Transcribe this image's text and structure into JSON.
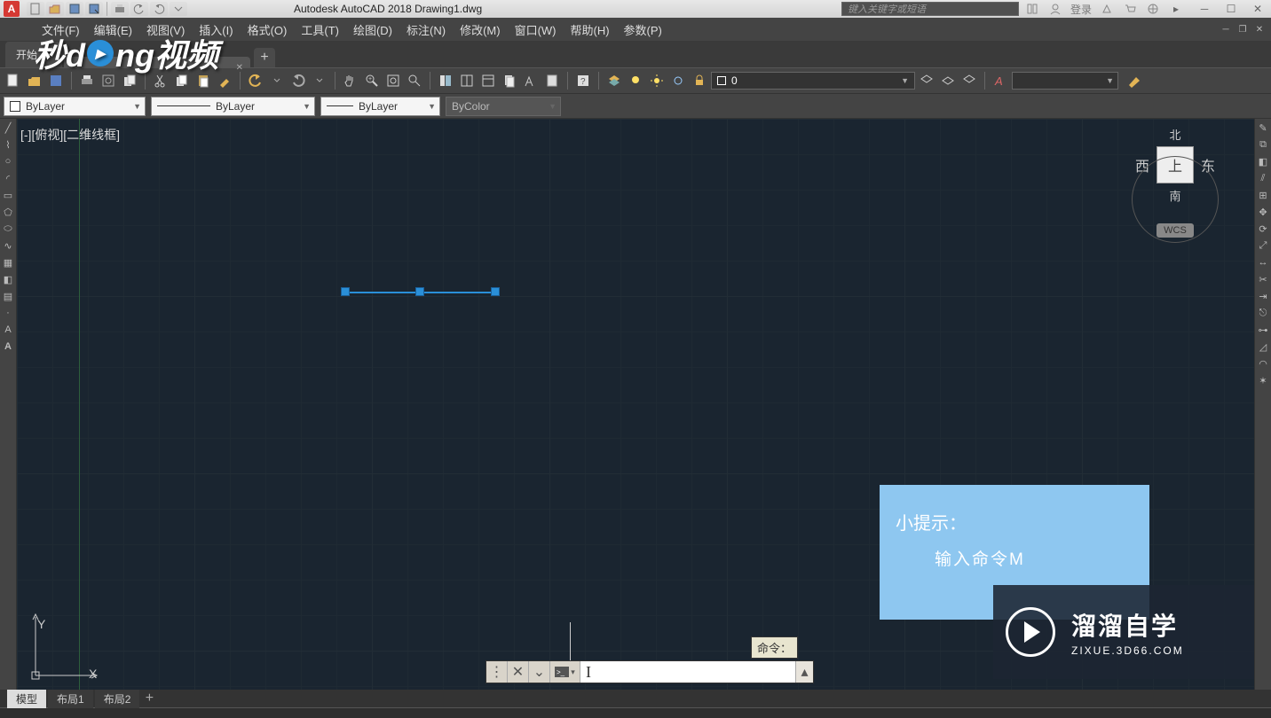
{
  "app": {
    "title": "Autodesk AutoCAD 2018   Drawing1.dwg",
    "search_placeholder": "键入关键字或短语",
    "login_label": "登录"
  },
  "menu": {
    "items": [
      "文件(F)",
      "编辑(E)",
      "视图(V)",
      "插入(I)",
      "格式(O)",
      "工具(T)",
      "绘图(D)",
      "标注(N)",
      "修改(M)",
      "窗口(W)",
      "帮助(H)",
      "参数(P)"
    ]
  },
  "tabs": {
    "start": "开始",
    "add": "+"
  },
  "layer": {
    "current": "0",
    "bylayer_color": "ByLayer",
    "bylayer_ltype": "ByLayer",
    "bylayer_lweight": "ByLayer",
    "bycolor": "ByColor"
  },
  "view": {
    "label": "[-][俯视][二维线框]"
  },
  "navcube": {
    "north": "北",
    "south": "南",
    "east": "东",
    "west": "西",
    "top": "上",
    "wcs": "WCS"
  },
  "tip": {
    "title": "小提示：",
    "body": "输入命令M"
  },
  "cmd_tooltip": "命令：",
  "zixue": {
    "big": "溜溜自学",
    "small": "ZIXUE.3D66.COM"
  },
  "layout": {
    "model": "模型",
    "l1": "布局1",
    "l2": "布局2",
    "add": "+"
  },
  "logo": {
    "p1": "秒d",
    "p2": "ng视频"
  }
}
